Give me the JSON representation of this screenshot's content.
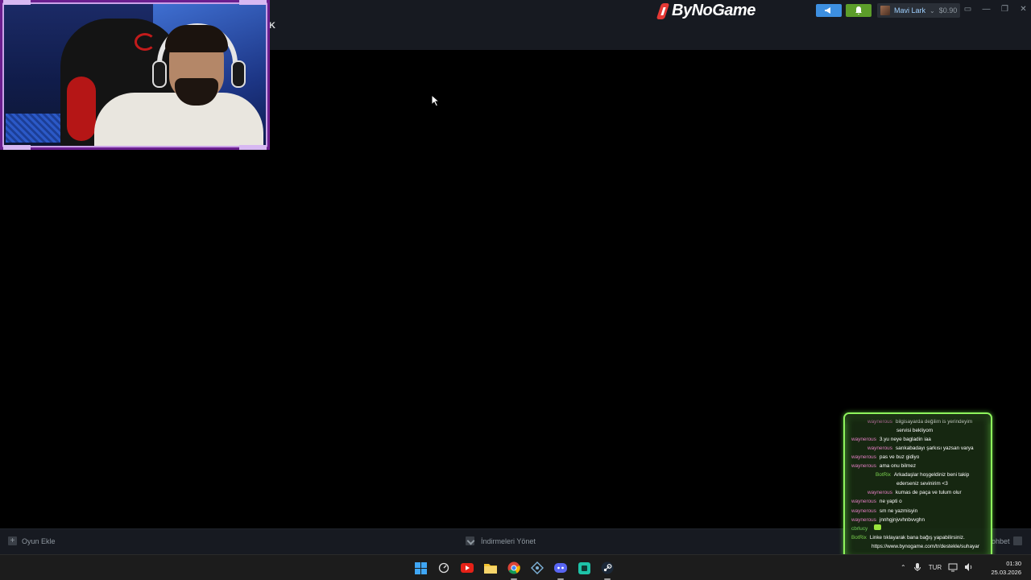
{
  "topbar": {
    "cut_text": "K",
    "brand_name": "ByNoGame",
    "announce_icon": "megaphone-icon",
    "notify_icon": "bell-icon",
    "user_name": "Mavi Lark",
    "wallet": "$0.90",
    "colors": {
      "announce": "#3d8fe0",
      "notify": "#5c9d2a",
      "bar": "#171a21"
    }
  },
  "bottombar": {
    "add_game": "Oyun Ekle",
    "downloads": "İndirmeleri Yönet",
    "friends_partial": "ohbet"
  },
  "chat": {
    "border_color": "#8ef35c",
    "lines": [
      {
        "nick": "waynerous",
        "msg": "bilgisayarda değilim is yerindeyim",
        "style": "indent"
      },
      {
        "nick": "",
        "msg": "servisi bekliyom",
        "style": "cont"
      },
      {
        "nick": "waynerous",
        "msg": "3.yu neye bagladin iaa",
        "style": ""
      },
      {
        "nick": "waynerous",
        "msg": "sarıkabadayı şarkısı yazsan varya",
        "style": "indent"
      },
      {
        "nick": "waynerous",
        "msg": "pas ve buz gidiyo",
        "style": ""
      },
      {
        "nick": "waynerous",
        "msg": "ama onu bilmez",
        "style": ""
      },
      {
        "nick": "BotRix",
        "msg": "Arkadaşlar hoşgeldiniz beni takip",
        "style": "indent2 bot"
      },
      {
        "nick": "",
        "msg": "ederseniz sevinirim <3",
        "style": "cont"
      },
      {
        "nick": "waynerous",
        "msg": "kumas de paça ve tulum olur",
        "style": "indent"
      },
      {
        "nick": "waynerous",
        "msg": "ne yapti o",
        "style": ""
      },
      {
        "nick": "waynerous",
        "msg": "sm ne yazmisyin",
        "style": ""
      },
      {
        "nick": "waynerous",
        "msg": "jnnhgjnjvvhnbvvghn",
        "style": ""
      },
      {
        "nick": "cbrlucy",
        "msg": "",
        "style": "cb emote"
      },
      {
        "nick": "BotRix",
        "msg": "Linke tıklayarak bana bağış yapabilirsiniz.",
        "style": "bot"
      },
      {
        "nick": "",
        "msg": "https://www.bynogame.com/tr/destekle/suhayar",
        "style": "link"
      }
    ]
  },
  "taskbar": {
    "icons": [
      "windows-start-icon",
      "speedometer-icon",
      "youtube-icon",
      "file-explorer-icon",
      "chrome-icon",
      "network-app-icon",
      "discord-icon",
      "teal-app-icon",
      "steam-icon"
    ],
    "language": "TUR",
    "time": "01:30",
    "date": "25.03.2026"
  }
}
